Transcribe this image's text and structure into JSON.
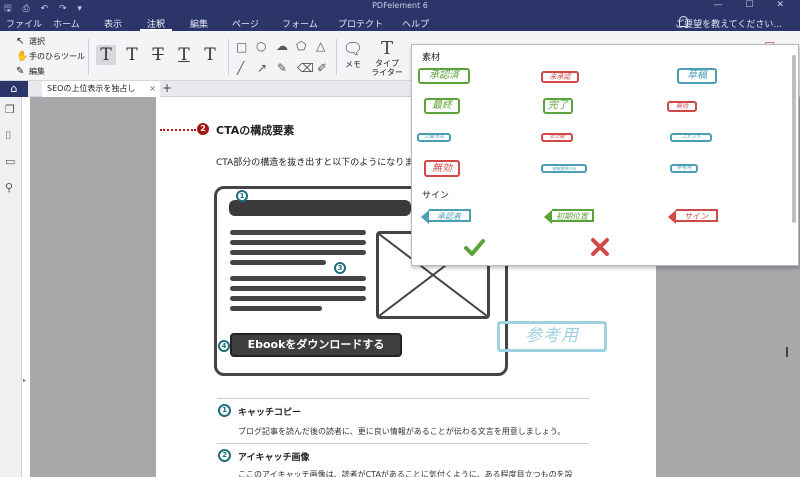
{
  "titlebar": {
    "app_title": "PDFelement 6",
    "quick_access": "🖫 ⎙ ↶ ↷ ▾",
    "window_controls": "— ☐ ✕"
  },
  "menu": {
    "items": [
      "ファイル",
      "ホーム",
      "表示",
      "注釈",
      "編集",
      "ページ",
      "フォーム",
      "プロテクト",
      "ヘルプ"
    ],
    "active_index": 3,
    "help_search": "ご要望を教えてください..."
  },
  "toolbar": {
    "select": "選択",
    "hand": "手のひらツール",
    "edit": "編集",
    "text_tool_glyphs": [
      "T",
      "T",
      "T",
      "T",
      "T"
    ],
    "memo": "メモ",
    "typewriter_line1": "タイプ",
    "typewriter_line2": "ライター"
  },
  "tabs": {
    "home_icon": "⌂",
    "doc_tab": "SEOの上位表示を独占し",
    "close": "×",
    "add": "+"
  },
  "document": {
    "section_number": "2",
    "section_title": "CTAの構成要素",
    "intro": "CTA部分の構造を抜き出すと以下のようになります。",
    "markers": [
      "1",
      "3",
      "4"
    ],
    "cta_button_text": "Ebookをダウンロードする",
    "ref_stamp": "参考用",
    "items": [
      {
        "number": "1",
        "title": "キャッチコピー",
        "text": "ブログ記事を読んだ後の読者に、更に良い情報があることが伝わる文言を用意しましょう。"
      },
      {
        "number": "2",
        "title": "アイキャッチ画像",
        "text": "ここのアイキャッチ画像は、読者がCTAがあることに気付くように、ある程度目立つものを設"
      }
    ]
  },
  "stamp_panel": {
    "section_material": "素材",
    "section_sign": "サイン",
    "stamps": [
      {
        "text": "承認済",
        "color": "#5aa33a"
      },
      {
        "text": "未承認",
        "color": "#d04848"
      },
      {
        "text": "草稿",
        "color": "#4a9fb5"
      },
      {
        "text": "最終",
        "color": "#5aa33a"
      },
      {
        "text": "完了",
        "color": "#5aa33a"
      },
      {
        "text": "無効",
        "color": "#d04848"
      },
      {
        "text": "公開済み",
        "color": "#4a9fb5"
      },
      {
        "text": "非公開",
        "color": "#d04848"
      },
      {
        "text": "コメント",
        "color": "#4a9fb5"
      },
      {
        "text": "無効",
        "color": "#d04848"
      },
      {
        "text": "情報提供のみ",
        "color": "#4a9fb5"
      },
      {
        "text": "参考用",
        "color": "#4a9fb5"
      }
    ],
    "signs": [
      {
        "text": "承認者",
        "color": "#4a9fb5"
      },
      {
        "text": "初期位置",
        "color": "#5aa33a"
      },
      {
        "text": "サイン",
        "color": "#d04848"
      }
    ],
    "accent_ok": "#5aa33a",
    "accent_cancel": "#d04848"
  }
}
